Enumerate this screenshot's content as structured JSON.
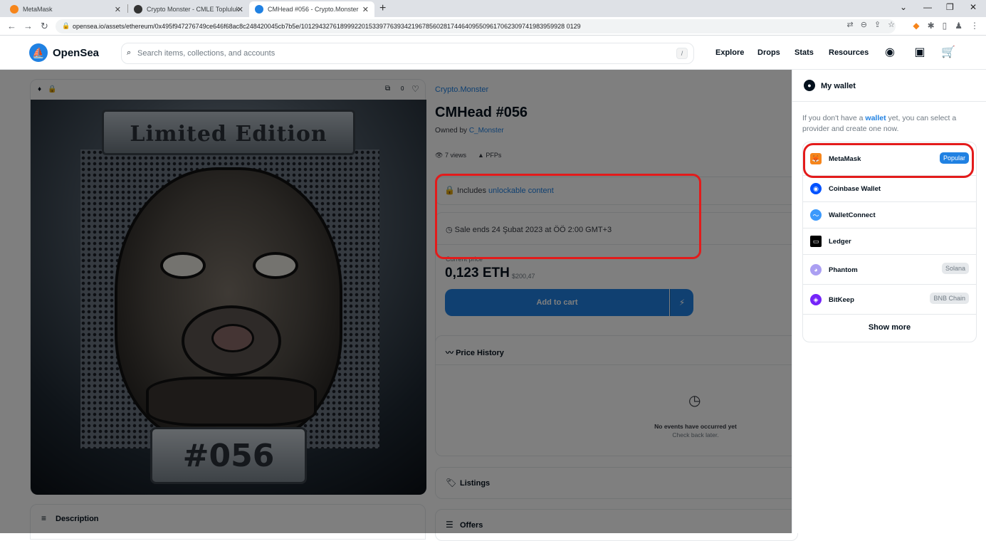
{
  "browser": {
    "tabs": [
      {
        "label": "MetaMask",
        "close": "✕"
      },
      {
        "label": "Crypto Monster - CMLE Topluluk",
        "close": "✕"
      },
      {
        "label": "CMHead #056 - Crypto.Monster",
        "close": "✕"
      }
    ],
    "new_tab": "+",
    "url": "opensea.io/assets/ethereum/0x495f947276749ce646f68ac8c248420045cb7b5e/10129432761899922015339776393421967856028174464095509617062309741983959928 0129"
  },
  "header": {
    "logo_text": "OpenSea",
    "search_placeholder": "Search items, collections, and accounts",
    "search_shortcut": "/",
    "nav": [
      "Explore",
      "Drops",
      "Stats",
      "Resources"
    ]
  },
  "asset": {
    "collection": "Crypto.Monster",
    "title": "CMHead #056",
    "owned_prefix": "Owned by",
    "owner": "C_Monster",
    "views": "7 views",
    "category": "PFPs",
    "favorites": "0",
    "image_banner_text": "Limited Edition",
    "image_plate_text": "#056",
    "unlock_prefix": "Includes",
    "unlock_link": "unlockable content",
    "sale_ends": "Sale ends 24 Şubat 2023 at ÖÖ 2:00 GMT+3",
    "current_price_label": "Current price",
    "price": "0,123 ETH",
    "price_usd": "$200,47",
    "add_to_cart": "Add to cart",
    "price_history_label": "Price History",
    "no_events": "No events have occurred yet",
    "check_back": "Check back later.",
    "listings_label": "Listings",
    "offers_label": "Offers",
    "description_label": "Description"
  },
  "wallet_panel": {
    "title": "My wallet",
    "intro_prefix": "If you don't have a",
    "intro_link": "wallet",
    "intro_suffix": "yet, you can select a provider and create one now.",
    "providers": [
      {
        "name": "MetaMask",
        "badge": "Popular",
        "icon": "metamask-fox-icon",
        "color": "#f6851b"
      },
      {
        "name": "Coinbase Wallet",
        "badge": "",
        "icon": "coinbase-icon",
        "color": "#0052ff"
      },
      {
        "name": "WalletConnect",
        "badge": "",
        "icon": "walletconnect-icon",
        "color": "#3b99fc"
      },
      {
        "name": "Ledger",
        "badge": "",
        "icon": "ledger-icon",
        "color": "#000000"
      },
      {
        "name": "Phantom",
        "badge": "Solana",
        "icon": "phantom-icon",
        "color": "#ab9ff2"
      },
      {
        "name": "BitKeep",
        "badge": "BNB Chain",
        "icon": "bitkeep-icon",
        "color": "#7524f9"
      }
    ],
    "show_more": "Show more"
  },
  "colors": {
    "accent": "#2081e2",
    "highlight": "#e31b1b"
  }
}
